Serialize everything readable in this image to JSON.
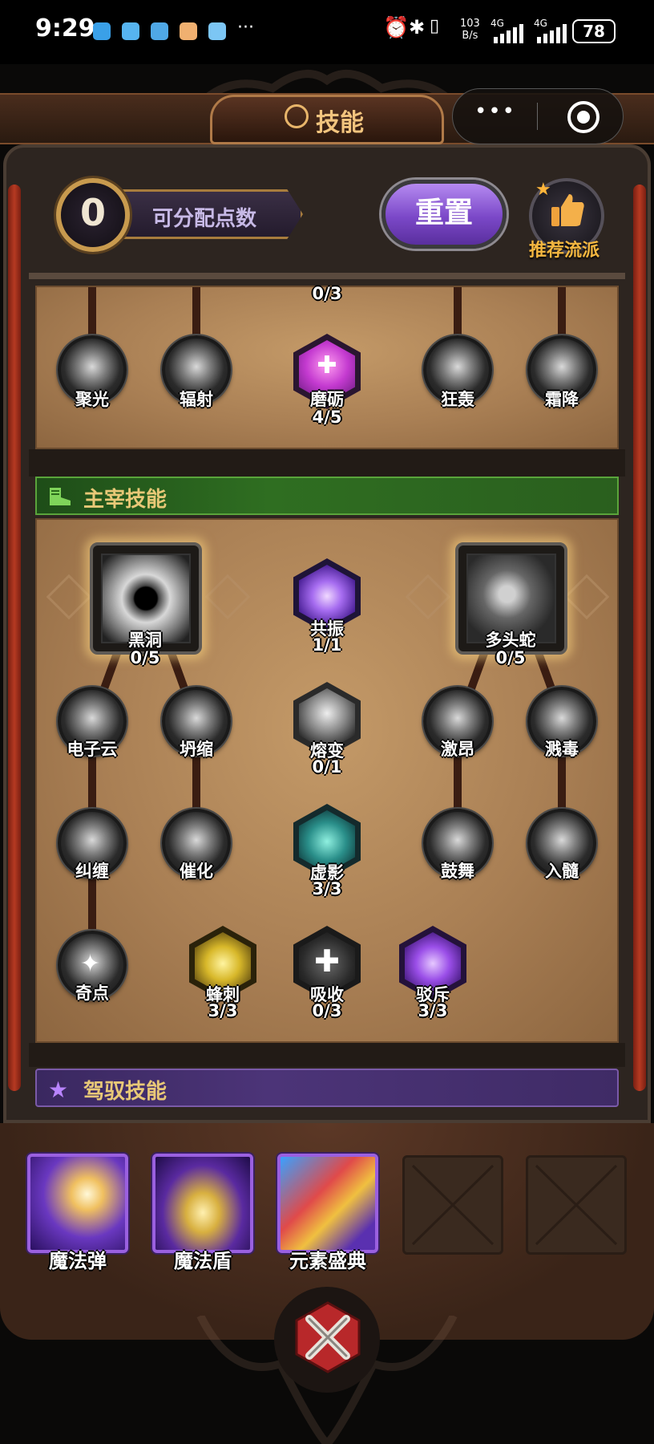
{
  "status_bar": {
    "time": "9:29",
    "more": "···",
    "net_speed_value": "103",
    "net_speed_unit": "B/s",
    "signal1": "4G",
    "signal2": "4G",
    "battery": "78"
  },
  "header": {
    "title": "技能",
    "capsule_more": "•••"
  },
  "points": {
    "value": "0",
    "label": "可分配点数"
  },
  "reset_label": "重置",
  "recommend_label": "推荐流派",
  "top_panel": {
    "header_count": "0/3",
    "nodes": [
      {
        "label": "聚光",
        "count": ""
      },
      {
        "label": "辐射",
        "count": ""
      },
      {
        "label": "磨砺",
        "count": "4/5"
      },
      {
        "label": "狂轰",
        "count": ""
      },
      {
        "label": "霜降",
        "count": ""
      }
    ]
  },
  "master_section": {
    "title": "主宰技能",
    "tier1": [
      {
        "label": "黑洞",
        "count": "0/5"
      },
      {
        "label": "共振",
        "count": "1/1"
      },
      {
        "label": "多头蛇",
        "count": "0/5"
      }
    ],
    "tier2": [
      {
        "label": "电子云",
        "count": ""
      },
      {
        "label": "坍缩",
        "count": ""
      },
      {
        "label": "熔变",
        "count": "0/1"
      },
      {
        "label": "激昂",
        "count": ""
      },
      {
        "label": "溅毒",
        "count": ""
      }
    ],
    "tier3": [
      {
        "label": "纠缠",
        "count": ""
      },
      {
        "label": "催化",
        "count": ""
      },
      {
        "label": "虚影",
        "count": "3/3"
      },
      {
        "label": "鼓舞",
        "count": ""
      },
      {
        "label": "入髓",
        "count": ""
      }
    ],
    "tier4": [
      {
        "label": "奇点",
        "count": ""
      },
      {
        "label": "蜂刺",
        "count": "3/3"
      },
      {
        "label": "吸收",
        "count": "0/3"
      },
      {
        "label": "驳斥",
        "count": "3/3"
      }
    ]
  },
  "drive_section": {
    "title": "驾驭技能"
  },
  "equipped": [
    {
      "label": "魔法弹"
    },
    {
      "label": "魔法盾"
    },
    {
      "label": "元素盛典"
    },
    {
      "label": ""
    },
    {
      "label": ""
    }
  ],
  "colors": {
    "accent_gold": "#f2c47e",
    "reset_purple": "#7b48c8",
    "master_green": "#2f6e21",
    "drive_purple": "#4c3478"
  }
}
